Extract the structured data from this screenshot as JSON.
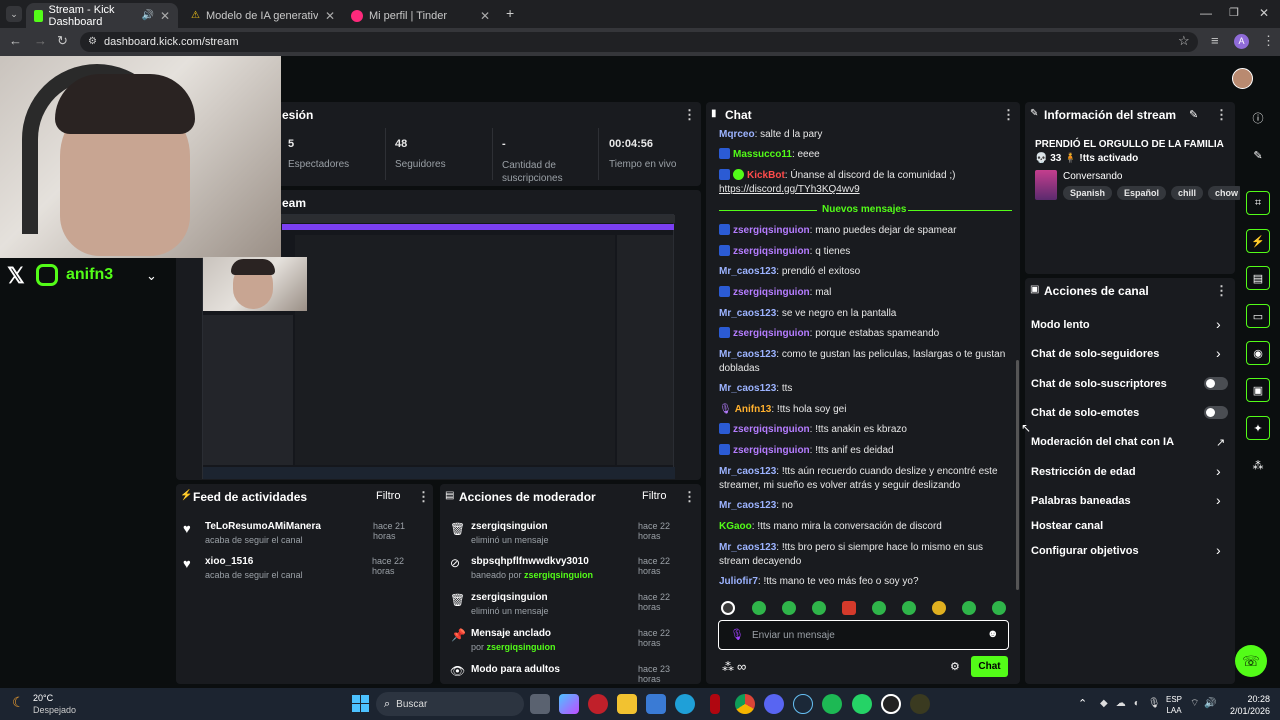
{
  "browser": {
    "tabs": [
      {
        "label": "Stream - Kick Dashboard",
        "favicon_color": "#53fc18"
      },
      {
        "label": "Modelo de IA generativa de Se",
        "favicon_color": "#f5c518"
      },
      {
        "label": "Mi perfil | Tinder",
        "favicon_color": "#fd297b"
      }
    ],
    "url": "dashboard.kick.com/stream",
    "profile_initial": "A"
  },
  "overlay": {
    "handle": "anifn3"
  },
  "session": {
    "title": "esión",
    "stats": [
      {
        "value": "5",
        "label": "Espectadores"
      },
      {
        "value": "48",
        "label": "Seguidores"
      },
      {
        "value": "-",
        "label": "Cantidad de suscripciones"
      },
      {
        "value": "00:04:56",
        "label": "Tiempo en vivo"
      }
    ],
    "preview_title": "eam"
  },
  "feed": {
    "title": "Feed de actividades",
    "filter": "Filtro",
    "items": [
      {
        "name": "TeLoResumoAMiManera",
        "sub": "acaba de seguir el canal",
        "time": "hace 21 horas"
      },
      {
        "name": "xioo_1516",
        "sub": "acaba de seguir el canal",
        "time": "hace 22 horas"
      }
    ]
  },
  "modactions": {
    "title": "Acciones de moderador",
    "filter": "Filtro",
    "items": [
      {
        "name": "zsergiqsinguion",
        "sub": "eliminó un mensaje",
        "by": "",
        "time": "hace 22 horas",
        "icon": "trash-icon"
      },
      {
        "name": "sbpsqhpflfnwwdkvy3010",
        "sub": "baneado por ",
        "by": "zsergiqsinguion",
        "time": "hace 22 horas",
        "icon": "ban-icon"
      },
      {
        "name": "zsergiqsinguion",
        "sub": "eliminó un mensaje",
        "by": "",
        "time": "hace 22 horas",
        "icon": "trash-icon"
      },
      {
        "name": "Mensaje anclado",
        "sub": "por ",
        "by": "zsergiqsinguion",
        "time": "hace 22 horas",
        "icon": "pin-icon"
      },
      {
        "name": "Modo para adultos",
        "sub": "",
        "by": "",
        "time": "hace 23 horas",
        "icon": "eye-icon"
      }
    ]
  },
  "chat": {
    "title": "Chat",
    "new_messages": "Nuevos mensajes",
    "input_placeholder": "Enviar un mensaje",
    "send_label": "Chat",
    "messages": [
      {
        "user": "Mqrceo",
        "text": ": salte d la pary",
        "color": "blue",
        "badge": ""
      },
      {
        "user": "Massucco11",
        "text": ": eeee",
        "color": "green",
        "badge": "b"
      },
      {
        "user": "KickBot",
        "text": ": Únanse al discord de la comunidad ;)",
        "color": "red",
        "badge": "b"
      },
      {
        "user": "",
        "text": "https://discord.gg/TYh3KQ4wv9",
        "color": "",
        "badge": ""
      },
      {
        "user": "zsergiqsinguion",
        "text": ": mano puedes dejar de spamear",
        "color": "purple",
        "badge": "b"
      },
      {
        "user": "zsergiqsinguion",
        "text": ": q tienes",
        "color": "purple",
        "badge": "b"
      },
      {
        "user": "Mr_caos123",
        "text": ": prendió el exitoso",
        "color": "blue",
        "badge": ""
      },
      {
        "user": "zsergiqsinguion",
        "text": ": mal",
        "color": "purple",
        "badge": "b"
      },
      {
        "user": "Mr_caos123",
        "text": ": se ve negro en la pantalla",
        "color": "blue",
        "badge": ""
      },
      {
        "user": "zsergiqsinguion",
        "text": ": porque estabas spameando",
        "color": "purple",
        "badge": "b"
      },
      {
        "user": "Mr_caos123",
        "text": ": como te gustan las peliculas, laslargas o te gustan dobladas",
        "color": "blue",
        "badge": ""
      },
      {
        "user": "Mr_caos123",
        "text": ": tts",
        "color": "blue",
        "badge": ""
      },
      {
        "user": "Anifn13",
        "text": ": !tts hola soy gei",
        "color": "purple",
        "badge": "p"
      },
      {
        "user": "zsergiqsinguion",
        "text": ": !tts anakin es kbrazo",
        "color": "purple",
        "badge": "b"
      },
      {
        "user": "zsergiqsinguion",
        "text": ": !tts anif es deidad",
        "color": "purple",
        "badge": "b"
      },
      {
        "user": "Mr_caos123",
        "text": ": !tts aún recuerdo cuando deslize y encontré este streamer, mi sueño es volver atrás y seguir deslizando",
        "color": "blue",
        "badge": ""
      },
      {
        "user": "Mr_caos123",
        "text": ": no",
        "color": "blue",
        "badge": ""
      },
      {
        "user": "KGaoo",
        "text": ": !tts mano mira la conversación de discord",
        "color": "green",
        "badge": ""
      },
      {
        "user": "Mr_caos123",
        "text": ": !tts bro pero si siempre hace lo mismo en sus stream decayendo",
        "color": "blue",
        "badge": ""
      },
      {
        "user": "Juliofir7",
        "text": ": !tts mano te veo más feo o soy yo?",
        "color": "blue",
        "badge": ""
      }
    ]
  },
  "streaminfo": {
    "title": "Información del stream",
    "stream_title": "PRENDIÓ EL ORGULLO DE LA FAMILIA 💀 33 🧍 !tts activado",
    "category": "Conversando",
    "tags": [
      "Spanish",
      "Español",
      "chill",
      "chow"
    ]
  },
  "channel_actions": {
    "title": "Acciones de canal",
    "items": [
      {
        "label": "Modo lento",
        "kind": "chevron"
      },
      {
        "label": "Chat de solo-seguidores",
        "kind": "chevron"
      },
      {
        "label": "Chat de solo-suscriptores",
        "kind": "toggle"
      },
      {
        "label": "Chat de solo-emotes",
        "kind": "toggle"
      },
      {
        "label": "Moderación del chat con IA",
        "kind": "external"
      },
      {
        "label": "Restricción de edad",
        "kind": "chevron"
      },
      {
        "label": "Palabras baneadas",
        "kind": "chevron"
      },
      {
        "label": "Hostear canal",
        "kind": "none"
      },
      {
        "label": "Configurar objetivos",
        "kind": "chevron"
      }
    ]
  },
  "taskbar": {
    "weather_temp": "20°C",
    "weather_desc": "Despejado",
    "search": "Buscar",
    "lang_1": "ESP",
    "lang_2": "LAA",
    "time": "20:28",
    "date": "2/01/2026"
  },
  "colors": {
    "accent": "#53fc18",
    "panel": "#191b1f",
    "background": "#0b0e0f"
  }
}
